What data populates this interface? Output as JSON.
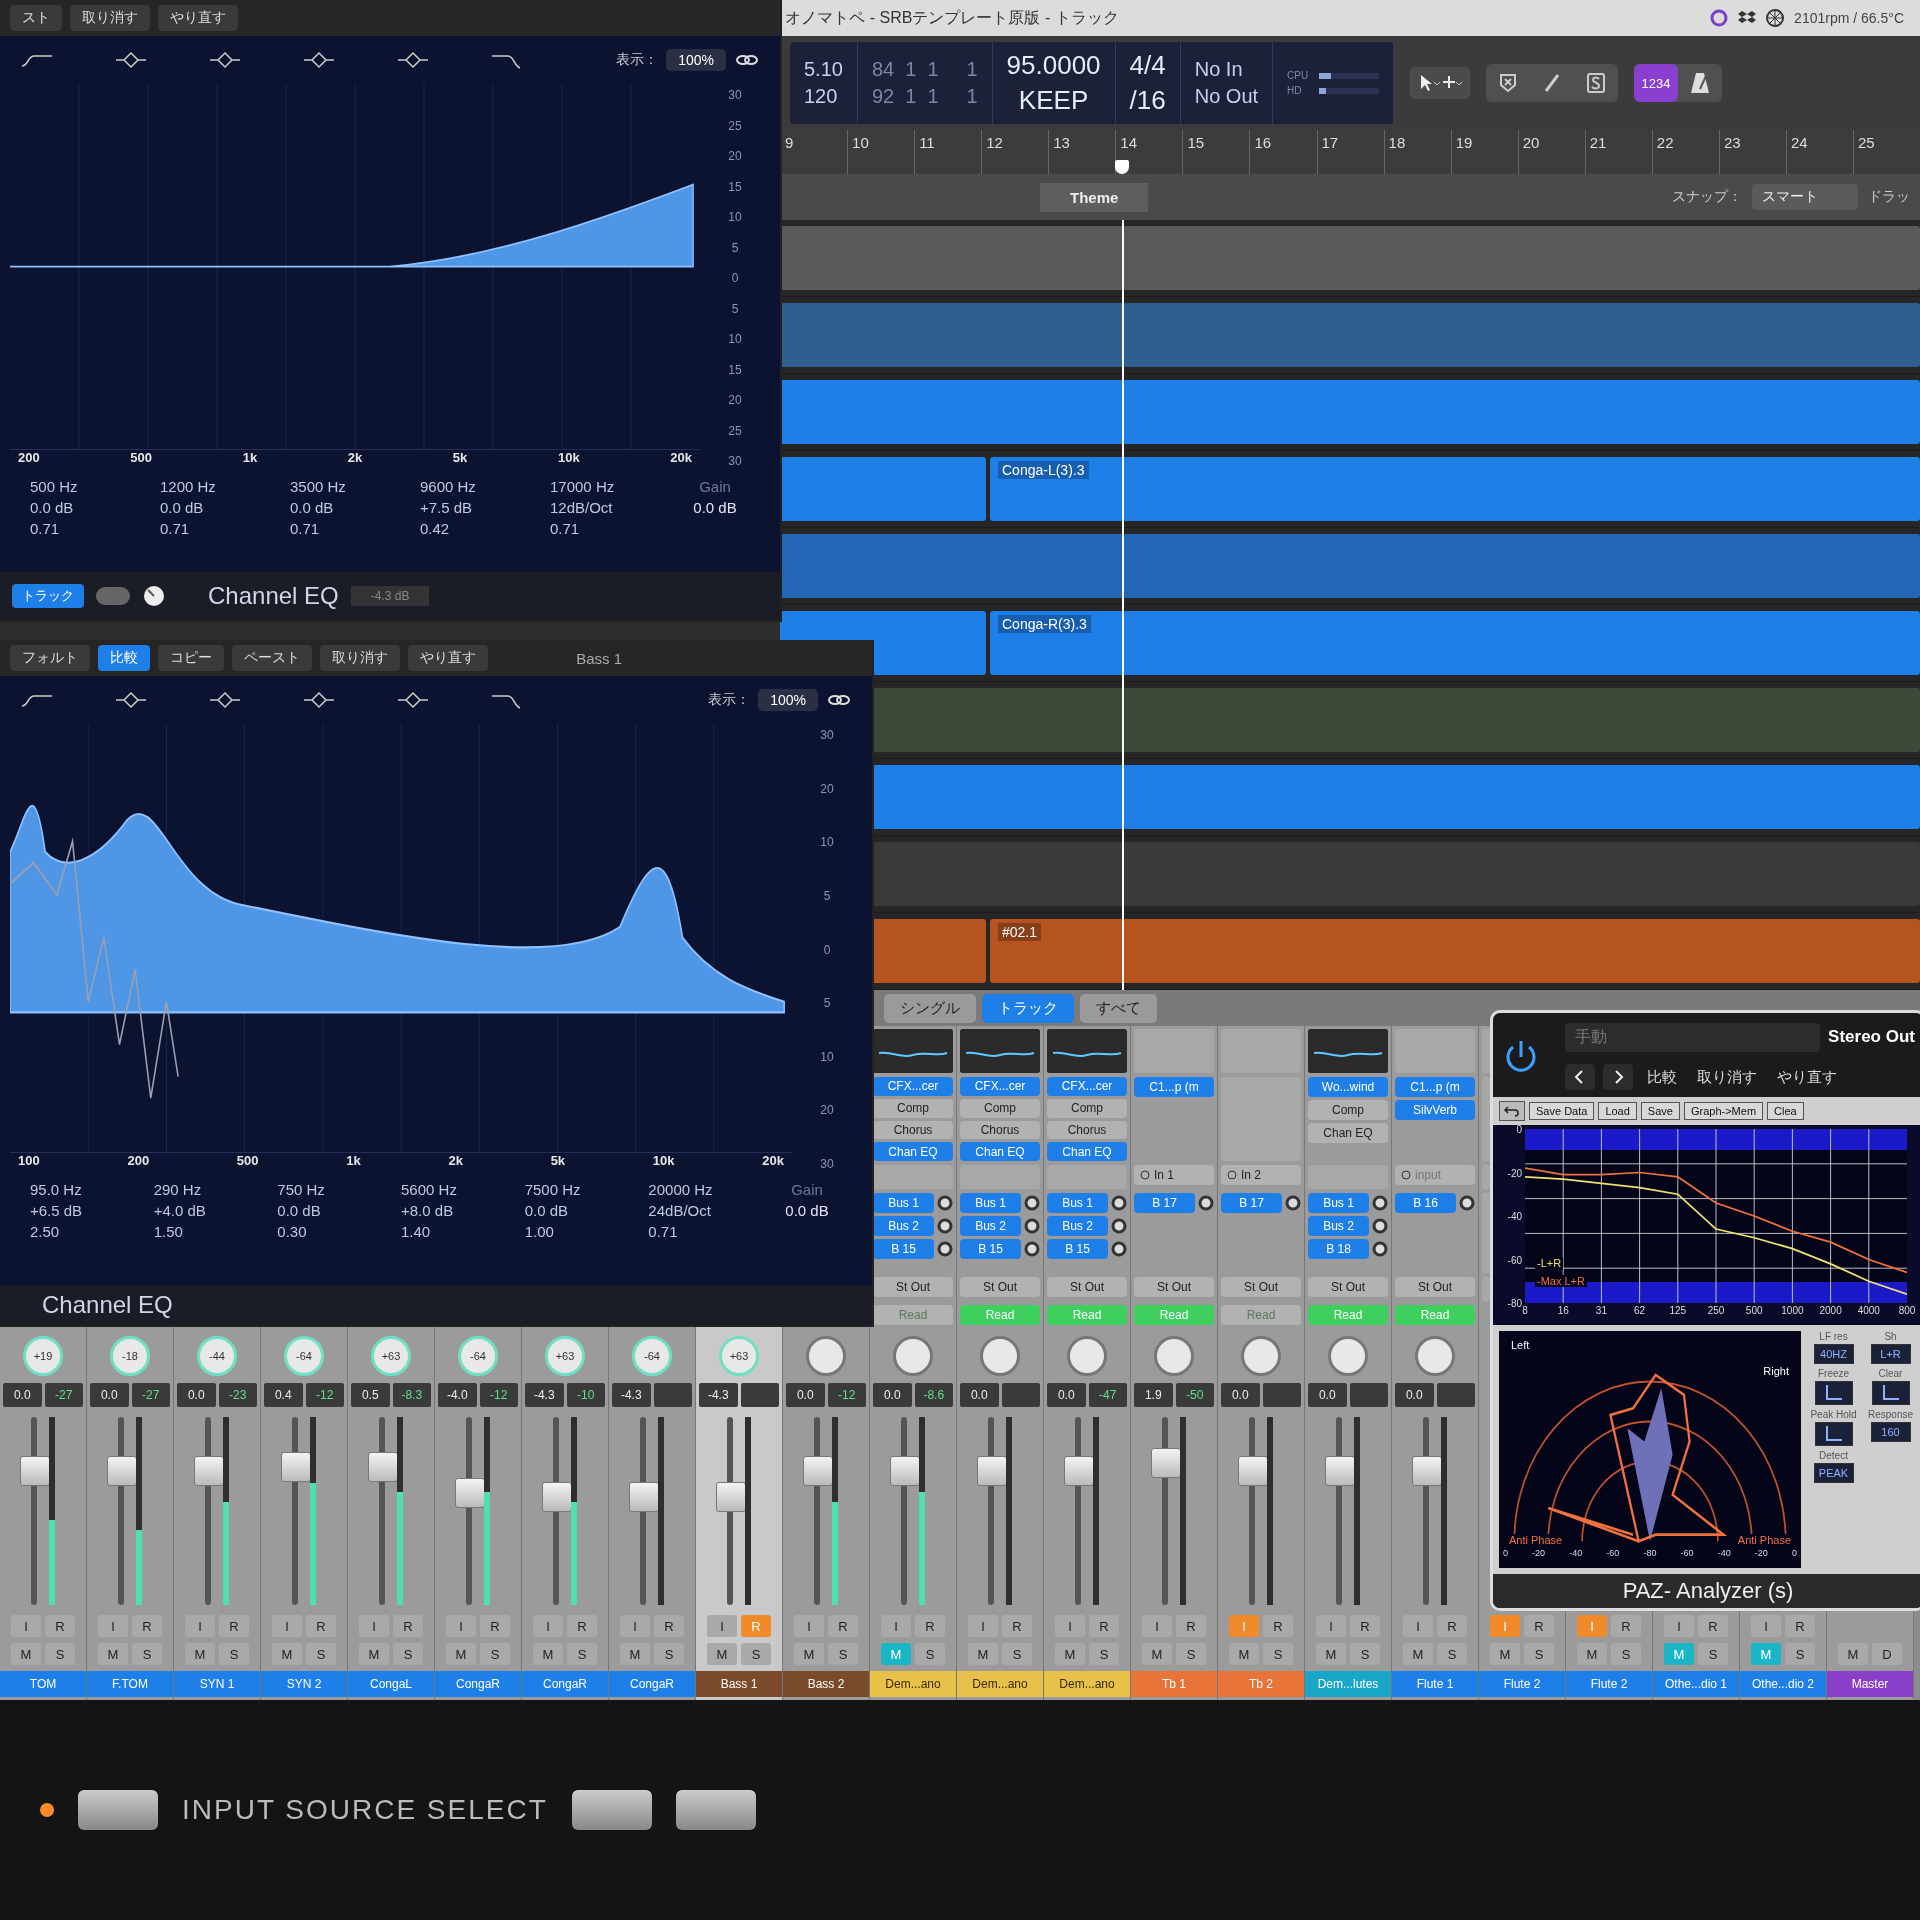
{
  "title_bar": {
    "title": "オノマトペ - SRBテンプレート原版 - トラック",
    "status": "2101rpm / 66.5°C"
  },
  "control_bar": {
    "lcd": [
      {
        "kind": "bright",
        "lines": [
          "5.10",
          "120"
        ]
      },
      {
        "kind": "dim",
        "lines": [
          "84  1  1     1",
          "92  1  1     1"
        ]
      },
      {
        "kind": "big",
        "lines": [
          "95.0000",
          "KEEP"
        ]
      },
      {
        "kind": "big",
        "lines": [
          "4/4",
          "/16"
        ]
      },
      {
        "kind": "bright",
        "lines": [
          "No In",
          "No Out"
        ]
      },
      {
        "kind": "meters",
        "meters": [
          {
            "label": "CPU",
            "level": 0.2
          },
          {
            "label": "HD",
            "level": 0.12
          }
        ]
      }
    ],
    "count_in": {
      "label": "1234",
      "on": true
    },
    "metronome": {
      "on": false
    }
  },
  "ruler": {
    "bars": [
      "9",
      "10",
      "11",
      "12",
      "13",
      "14",
      "15",
      "16",
      "17",
      "18",
      "19",
      "20",
      "21",
      "22",
      "23",
      "24",
      "25"
    ],
    "playhead": {
      "level": 0.3
    },
    "marker": "Theme",
    "snap_label": "スナップ：",
    "snap_value": "スマート",
    "drag_label": "ドラッ"
  },
  "tracks": [
    {
      "regions": [
        {
          "color": "#5a5a5a"
        }
      ]
    },
    {
      "regions": [
        {
          "color": "#2f5f8f"
        }
      ]
    },
    {
      "regions": [
        {
          "color": "#1f7fe8"
        }
      ]
    },
    {
      "regions": [
        {
          "color": "#1f7fe8"
        },
        {
          "label": "Conga-L(3).3",
          "color": "#1f7fe8"
        }
      ]
    },
    {
      "regions": [
        {
          "color": "#2366b8"
        }
      ]
    },
    {
      "regions": [
        {
          "color": "#1f7fe8"
        },
        {
          "label": "Conga-R(3).3",
          "color": "#1f7fe8"
        }
      ]
    },
    {
      "regions": [
        {
          "color": "#3d4a3a"
        }
      ]
    },
    {
      "regions": [
        {
          "color": "#1f7fe8"
        }
      ]
    },
    {
      "regions": [
        {
          "color": "#3a3a3a"
        }
      ]
    },
    {
      "regions": [
        {
          "color": "#b5541f"
        },
        {
          "label": "#02.1",
          "color": "#b5541f"
        }
      ]
    }
  ],
  "channel_eq_windows": [
    {
      "kind": "treble",
      "toolbar": [
        {
          "label": "スト",
          "selected": false
        },
        {
          "label": "取り消す",
          "selected": false
        },
        {
          "label": "やり直す",
          "selected": false
        }
      ],
      "display_label": "表示：",
      "zoom": "100%",
      "freq_labels": [
        "200",
        "500",
        "1k",
        "2k",
        "5k",
        "10k",
        "20k"
      ],
      "gain_scale": [
        "30",
        "25",
        "20",
        "15",
        "10",
        "5",
        "0",
        "5",
        "10",
        "15",
        "20",
        "25",
        "30"
      ],
      "bands": [
        {
          "lines": [
            "500 Hz",
            "0.0 dB",
            "0.71"
          ]
        },
        {
          "lines": [
            "1200 Hz",
            "0.0 dB",
            "0.71"
          ]
        },
        {
          "lines": [
            "3500 Hz",
            "0.0 dB",
            "0.71"
          ]
        },
        {
          "lines": [
            "9600 Hz",
            "+7.5 dB",
            "0.42"
          ]
        },
        {
          "lines": [
            "17000 Hz",
            "12dB/Oct",
            "0.71"
          ]
        }
      ],
      "gain_label": "Gain",
      "gain_value": "0.0 dB",
      "name": "Channel EQ",
      "footer": {
        "mode": "トラック",
        "toggle_on": false,
        "level_text": "-4.3 dB"
      }
    },
    {
      "kind": "bass",
      "title": "Bass 1",
      "toolbar": [
        {
          "label": "フォルト",
          "selected": false
        },
        {
          "label": "比較",
          "selected": true
        },
        {
          "label": "コピー",
          "selected": false
        },
        {
          "label": "ペースト",
          "selected": false
        },
        {
          "label": "取り消す",
          "selected": false
        },
        {
          "label": "やり直す",
          "selected": false
        }
      ],
      "display_label": "表示：",
      "zoom": "100%",
      "freq_labels": [
        "100",
        "200",
        "500",
        "1k",
        "2k",
        "5k",
        "10k",
        "20k"
      ],
      "gain_scale": [
        "30",
        "20",
        "10",
        "5",
        "0",
        "5",
        "10",
        "20",
        "30"
      ],
      "bands": [
        {
          "lines": [
            "95.0 Hz",
            "+6.5 dB",
            "2.50"
          ]
        },
        {
          "lines": [
            "290 Hz",
            "+4.0 dB",
            "1.50"
          ]
        },
        {
          "lines": [
            "750 Hz",
            "0.0 dB",
            "0.30"
          ]
        },
        {
          "lines": [
            "5600 Hz",
            "+8.0 dB",
            "1.40"
          ]
        },
        {
          "lines": [
            "7500 Hz",
            "0.0 dB",
            "1.00"
          ]
        },
        {
          "lines": [
            "20000 Hz",
            "24dB/Oct",
            "0.71"
          ]
        }
      ],
      "gain_label": "Gain",
      "gain_value": "0.0 dB",
      "name": "Channel EQ"
    }
  ],
  "mixer": {
    "tabs": [
      {
        "label": "シングル",
        "selected": false
      },
      {
        "label": "トラック",
        "selected": true
      },
      {
        "label": "すべて",
        "selected": false
      }
    ],
    "strips": [
      {
        "name": "TOM",
        "color": "#1f7fe8",
        "selected": false,
        "pan": "+19",
        "volume": "0.0",
        "peak": "-27",
        "fader": {
          "level": 0.72
        },
        "meter": {
          "level": 0.45
        },
        "buttons": [
          {
            "kind": "input",
            "label": "I",
            "on": false
          },
          {
            "kind": "record",
            "label": "R",
            "on": false
          },
          {
            "kind": "mute",
            "label": "M",
            "on": false
          },
          {
            "kind": "solo",
            "label": "S",
            "on": false
          }
        ]
      },
      {
        "name": "F.TOM",
        "color": "#1f7fe8",
        "selected": false,
        "pan": "-18",
        "volume": "0.0",
        "peak": "-27",
        "fader": {
          "level": 0.72
        },
        "meter": {
          "level": 0.4
        },
        "buttons": [
          {
            "kind": "input",
            "label": "I",
            "on": false
          },
          {
            "kind": "record",
            "label": "R",
            "on": false
          },
          {
            "kind": "mute",
            "label": "M",
            "on": false
          },
          {
            "kind": "solo",
            "label": "S",
            "on": false
          }
        ]
      },
      {
        "name": "SYN 1",
        "color": "#1f7fe8",
        "selected": false,
        "pan": "-44",
        "volume": "0.0",
        "peak": "-23",
        "fader": {
          "level": 0.72
        },
        "meter": {
          "level": 0.55
        },
        "buttons": [
          {
            "kind": "input",
            "label": "I",
            "on": false
          },
          {
            "kind": "record",
            "label": "R",
            "on": false
          },
          {
            "kind": "mute",
            "label": "M",
            "on": false
          },
          {
            "kind": "solo",
            "label": "S",
            "on": false
          }
        ]
      },
      {
        "name": "SYN 2",
        "color": "#1f7fe8",
        "selected": false,
        "pan": "-64",
        "volume": "0.4",
        "peak": "-12",
        "fader": {
          "level": 0.74
        },
        "meter": {
          "level": 0.65
        },
        "buttons": [
          {
            "kind": "input",
            "label": "I",
            "on": false
          },
          {
            "kind": "record",
            "label": "R",
            "on": false
          },
          {
            "kind": "mute",
            "label": "M",
            "on": false
          },
          {
            "kind": "solo",
            "label": "S",
            "on": false
          }
        ]
      },
      {
        "name": "CongaL",
        "color": "#1f7fe8",
        "selected": false,
        "pan": "+63",
        "volume": "0.5",
        "peak": "-8.3",
        "fader": {
          "level": 0.74
        },
        "meter": {
          "level": 0.6
        },
        "buttons": [
          {
            "kind": "input",
            "label": "I",
            "on": false
          },
          {
            "kind": "record",
            "label": "R",
            "on": false
          },
          {
            "kind": "mute",
            "label": "M",
            "on": false
          },
          {
            "kind": "solo",
            "label": "S",
            "on": false
          }
        ]
      },
      {
        "name": "CongaR",
        "color": "#1f7fe8",
        "selected": false,
        "pan": "-64",
        "volume": "-4.0",
        "peak": "-12",
        "fader": {
          "level": 0.6
        },
        "meter": {
          "level": 0.6
        },
        "buttons": [
          {
            "kind": "input",
            "label": "I",
            "on": false
          },
          {
            "kind": "record",
            "label": "R",
            "on": false
          },
          {
            "kind": "mute",
            "label": "M",
            "on": false
          },
          {
            "kind": "solo",
            "label": "S",
            "on": false
          }
        ]
      },
      {
        "name": "CongaR",
        "color": "#1f7fe8",
        "selected": false,
        "pan": "+63",
        "volume": "-4.3",
        "peak": "-10",
        "fader": {
          "level": 0.58
        },
        "meter": {
          "level": 0.55
        },
        "buttons": [
          {
            "kind": "input",
            "label": "I",
            "on": false
          },
          {
            "kind": "record",
            "label": "R",
            "on": false
          },
          {
            "kind": "mute",
            "label": "M",
            "on": false
          },
          {
            "kind": "solo",
            "label": "S",
            "on": false
          }
        ]
      },
      {
        "name": "CongaR",
        "color": "#1f7fe8",
        "selected": false,
        "pan": "-64",
        "volume": "-4.3",
        "fader": {
          "level": 0.58
        },
        "meter": {
          "level": 0.0
        },
        "buttons": [
          {
            "kind": "input",
            "label": "I",
            "on": false
          },
          {
            "kind": "record",
            "label": "R",
            "on": false
          },
          {
            "kind": "mute",
            "label": "M",
            "on": false
          },
          {
            "kind": "solo",
            "label": "S",
            "on": false
          }
        ]
      },
      {
        "name": "Bass 1",
        "color": "#7a4a2a",
        "selected": true,
        "pan": "+63",
        "volume": "-4.3",
        "fader": {
          "level": 0.58
        },
        "meter": {
          "level": 0.0
        },
        "buttons": [
          {
            "kind": "input",
            "label": "I",
            "on": false
          },
          {
            "kind": "record",
            "label": "R",
            "on": true
          },
          {
            "kind": "mute",
            "label": "M",
            "on": false
          },
          {
            "kind": "solo",
            "label": "S",
            "on": false
          }
        ]
      },
      {
        "name": "Bass 2",
        "color": "#7a4a2a",
        "selected": false,
        "volume": "0.0",
        "peak": "-12",
        "fader": {
          "level": 0.72
        },
        "meter": {
          "level": 0.55
        },
        "buttons": [
          {
            "kind": "input",
            "label": "I",
            "on": false
          },
          {
            "kind": "record",
            "label": "R",
            "on": false
          },
          {
            "kind": "mute",
            "label": "M",
            "on": false
          },
          {
            "kind": "solo",
            "label": "S",
            "on": false
          }
        ]
      },
      {
        "name": "Dem...ano",
        "color": "#e8c14a",
        "selected": false,
        "eq_curve": true,
        "inserts": [
          {
            "label": "CFX...cer",
            "on": true
          },
          {
            "label": "Comp",
            "on": false
          },
          {
            "label": "Chorus",
            "on": false
          },
          {
            "label": "Chan EQ",
            "on": true
          }
        ],
        "sends": [
          "Bus 1",
          "Bus 2",
          "B 15"
        ],
        "output": "St Out",
        "automation": {
          "label": "Read",
          "on": false
        },
        "volume": "0.0",
        "peak": "-8.6",
        "fader": {
          "level": 0.72
        },
        "meter": {
          "level": 0.6
        },
        "buttons": [
          {
            "kind": "input",
            "label": "I",
            "on": false
          },
          {
            "kind": "record",
            "label": "R",
            "on": false
          },
          {
            "kind": "mute",
            "label": "M",
            "on": true
          },
          {
            "kind": "solo",
            "label": "S",
            "on": false
          }
        ]
      },
      {
        "name": "Dem...ano",
        "color": "#e8c14a",
        "selected": false,
        "eq_curve": true,
        "inserts": [
          {
            "label": "CFX...cer",
            "on": true
          },
          {
            "label": "Comp",
            "on": false
          },
          {
            "label": "Chorus",
            "on": false
          },
          {
            "label": "Chan EQ",
            "on": true
          }
        ],
        "sends": [
          "Bus 1",
          "Bus 2",
          "B 15"
        ],
        "output": "St Out",
        "automation": {
          "label": "Read",
          "on": true
        },
        "volume": "0.0",
        "fader": {
          "level": 0.72
        },
        "meter": {
          "level": 0.0
        },
        "buttons": [
          {
            "kind": "input",
            "label": "I",
            "on": false
          },
          {
            "kind": "record",
            "label": "R",
            "on": false
          },
          {
            "kind": "mute",
            "label": "M",
            "on": false
          },
          {
            "kind": "solo",
            "label": "S",
            "on": false
          }
        ]
      },
      {
        "name": "Dem...ano",
        "color": "#e8c14a",
        "selected": false,
        "eq_curve": true,
        "inserts": [
          {
            "label": "CFX...cer",
            "on": true
          },
          {
            "label": "Comp",
            "on": false
          },
          {
            "label": "Chorus",
            "on": false
          },
          {
            "label": "Chan EQ",
            "on": true
          }
        ],
        "sends": [
          "Bus 1",
          "Bus 2",
          "B 15"
        ],
        "output": "St Out",
        "automation": {
          "label": "Read",
          "on": true
        },
        "volume": "0.0",
        "peak": "-47",
        "fader": {
          "level": 0.72
        },
        "meter": {
          "level": 0.0
        },
        "buttons": [
          {
            "kind": "input",
            "label": "I",
            "on": false
          },
          {
            "kind": "record",
            "label": "R",
            "on": false
          },
          {
            "kind": "mute",
            "label": "M",
            "on": false
          },
          {
            "kind": "solo",
            "label": "S",
            "on": false
          }
        ]
      },
      {
        "name": "Tb 1",
        "color": "#e8743a",
        "selected": false,
        "input": {
          "label": "In 1",
          "on": true
        },
        "inserts": [
          {
            "label": "C1...p (m",
            "on": true
          }
        ],
        "sends": [
          "B 17"
        ],
        "output": "St Out",
        "automation": {
          "label": "Read",
          "on": true
        },
        "volume": "1.9",
        "peak": "-50",
        "fader": {
          "level": 0.76
        },
        "meter": {
          "level": 0.0
        },
        "buttons": [
          {
            "kind": "input",
            "label": "I",
            "on": false
          },
          {
            "kind": "record",
            "label": "R",
            "on": false
          },
          {
            "kind": "mute",
            "label": "M",
            "on": false
          },
          {
            "kind": "solo",
            "label": "S",
            "on": false
          }
        ]
      },
      {
        "name": "Tb 2",
        "color": "#e8743a",
        "selected": false,
        "input": {
          "label": "In 2",
          "on": true
        },
        "sends": [
          "B 17"
        ],
        "output": "St Out",
        "automation": {
          "label": "Read",
          "on": false
        },
        "volume": "0.0",
        "fader": {
          "level": 0.72
        },
        "meter": {
          "level": 0.0
        },
        "buttons": [
          {
            "kind": "input",
            "label": "I",
            "on": true
          },
          {
            "kind": "record",
            "label": "R",
            "on": false
          },
          {
            "kind": "mute",
            "label": "M",
            "on": false
          },
          {
            "kind": "solo",
            "label": "S",
            "on": false
          }
        ]
      },
      {
        "name": "Dem...lutes",
        "color": "#1aa6c8",
        "selected": false,
        "eq_curve": true,
        "inserts": [
          {
            "label": "Wo...wind",
            "on": true
          },
          {
            "label": "Comp",
            "on": false
          },
          {
            "label": "Chan EQ",
            "on": false
          }
        ],
        "sends": [
          "Bus 1",
          "Bus 2",
          "B 18"
        ],
        "output": "St Out",
        "automation": {
          "label": "Read",
          "on": true
        },
        "volume": "0.0",
        "fader": {
          "level": 0.72
        },
        "meter": {
          "level": 0.0
        },
        "buttons": [
          {
            "kind": "input",
            "label": "I",
            "on": false
          },
          {
            "kind": "record",
            "label": "R",
            "on": false
          },
          {
            "kind": "mute",
            "label": "M",
            "on": false
          },
          {
            "kind": "solo",
            "label": "S",
            "on": false
          }
        ]
      },
      {
        "name": "Flute 1",
        "color": "#1f7fe8",
        "selected": false,
        "input": {
          "label": "input",
          "on": false
        },
        "inserts": [
          {
            "label": "C1...p (m",
            "on": true
          },
          {
            "label": "SilvVerb",
            "on": true
          }
        ],
        "sends": [
          "B 16"
        ],
        "output": "St Out",
        "automation": {
          "label": "Read",
          "on": true
        },
        "volume": "0.0",
        "fader": {
          "level": 0.72
        },
        "meter": {
          "level": 0.0
        },
        "buttons": [
          {
            "kind": "input",
            "label": "I",
            "on": false
          },
          {
            "kind": "record",
            "label": "R",
            "on": false
          },
          {
            "kind": "mute",
            "label": "M",
            "on": false
          },
          {
            "kind": "solo",
            "label": "S",
            "on": false
          }
        ]
      },
      {
        "name": "Flute 2",
        "color": "#1f7fe8",
        "selected": false,
        "buttons": [
          {
            "kind": "input",
            "label": "I",
            "on": true
          },
          {
            "kind": "record",
            "label": "R",
            "on": false
          },
          {
            "kind": "mute",
            "label": "M",
            "on": false
          },
          {
            "kind": "solo",
            "label": "S",
            "on": false
          }
        ]
      },
      {
        "name": "Flute 2",
        "color": "#1f7fe8",
        "selected": false,
        "buttons": [
          {
            "kind": "input",
            "label": "I",
            "on": true
          },
          {
            "kind": "record",
            "label": "R",
            "on": false
          },
          {
            "kind": "mute",
            "label": "M",
            "on": false
          },
          {
            "kind": "solo",
            "label": "S",
            "on": false
          }
        ]
      },
      {
        "name": "Othe...dio 1",
        "color": "#1f7fe8",
        "selected": false,
        "buttons": [
          {
            "kind": "input",
            "label": "I",
            "on": false
          },
          {
            "kind": "record",
            "label": "R",
            "on": false
          },
          {
            "kind": "mute",
            "label": "M",
            "on": true
          },
          {
            "kind": "solo",
            "label": "S",
            "on": false
          }
        ]
      },
      {
        "name": "Othe...dio 2",
        "color": "#1f7fe8",
        "selected": false,
        "buttons": [
          {
            "kind": "input",
            "label": "I",
            "on": false
          },
          {
            "kind": "record",
            "label": "R",
            "on": false
          },
          {
            "kind": "mute",
            "label": "M",
            "on": true
          },
          {
            "kind": "solo",
            "label": "S",
            "on": false
          }
        ]
      },
      {
        "name": "Master",
        "color": "#8a3fc8",
        "selected": false,
        "buttons": [
          {
            "kind": "mute",
            "label": "M",
            "on": false
          },
          {
            "kind": "dim",
            "label": "D",
            "on": false
          }
        ]
      }
    ]
  },
  "paz_analyzer": {
    "preset": "手動",
    "output": "Stereo Out",
    "actions": [
      "比較",
      "取り消す",
      "やり直す"
    ],
    "buttons": [
      "Save Data",
      "Load",
      "Save",
      "Graph->Mem",
      "Clea"
    ],
    "spectrum": {
      "chart_data": {
        "type": "line",
        "categories": [
          "8",
          "16",
          "31",
          "62",
          "125",
          "250",
          "500",
          "1000",
          "2000",
          "4000",
          "800"
        ],
        "yticks": [
          0,
          -20,
          -40,
          -60,
          -80
        ],
        "ylim": [
          -80,
          0
        ],
        "grid": true,
        "series": [
          {
            "name": "-L+R",
            "color": "#f0e070",
            "values": [
              -22,
              -23,
              -25,
              -27,
              -30,
              -46,
              -50,
              -55,
              -62,
              -70,
              -76
            ]
          },
          {
            "name": "-Max L+R",
            "color": "#f07040",
            "values": [
              -18,
              -21,
              -21,
              -20,
              -22,
              -34,
              -40,
              -47,
              -52,
              -60,
              -66
            ]
          }
        ]
      }
    },
    "polar": {
      "left": "Left",
      "right": "Right",
      "anti_phase": [
        "Anti Phase",
        "Anti Phase"
      ],
      "scale": [
        "0",
        "-20",
        "-40",
        "-60",
        "-80",
        "-60",
        "-40",
        "-20",
        "0"
      ]
    },
    "controls": [
      {
        "kind": "value",
        "label": "LF res",
        "value": "40HZ"
      },
      {
        "kind": "value",
        "label": "Sh",
        "value": "L+R"
      },
      {
        "kind": "icon",
        "label": "Freeze"
      },
      {
        "kind": "icon",
        "label": "Clear"
      },
      {
        "kind": "icon",
        "label": "Peak Hold"
      },
      {
        "kind": "value",
        "label": "Response",
        "value": "160"
      },
      {
        "kind": "value",
        "label": "Detect",
        "value": "PEAK"
      }
    ],
    "title": "PAZ- Analyzer (s)"
  },
  "hardware": {
    "label": "INPUT SOURCE SELECT",
    "led_on": true
  }
}
